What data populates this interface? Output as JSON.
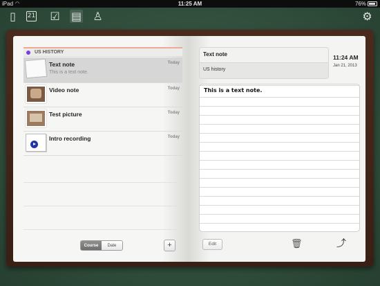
{
  "status_bar": {
    "carrier": "iPad",
    "time": "11:25 AM",
    "battery": "76%"
  },
  "toolbar": {
    "icons": [
      "notebooks-icon",
      "calendar-icon",
      "tasks-icon",
      "notes-icon",
      "teacher-icon",
      "settings-icon"
    ],
    "calendar_day": "21"
  },
  "notes_list": {
    "course_name": "US HISTORY",
    "course_color": "#7a3fe0",
    "items": [
      {
        "title": "Text note",
        "preview": "This is a text note.",
        "date": "Today",
        "kind": "text"
      },
      {
        "title": "Video note",
        "preview": "",
        "date": "Today",
        "kind": "video"
      },
      {
        "title": "Test picture",
        "preview": "",
        "date": "Today",
        "kind": "picture"
      },
      {
        "title": "Intro recording",
        "preview": "",
        "date": "Today",
        "kind": "audio"
      }
    ],
    "sort_options": [
      "Course",
      "Date"
    ],
    "sort_selected": "Course",
    "add_label": "+"
  },
  "detail": {
    "title": "Text note",
    "course": "US history",
    "time": "11:24 AM",
    "date": "Jan 21, 2013",
    "body": "This is a text note.",
    "edit_label": "Edit"
  }
}
